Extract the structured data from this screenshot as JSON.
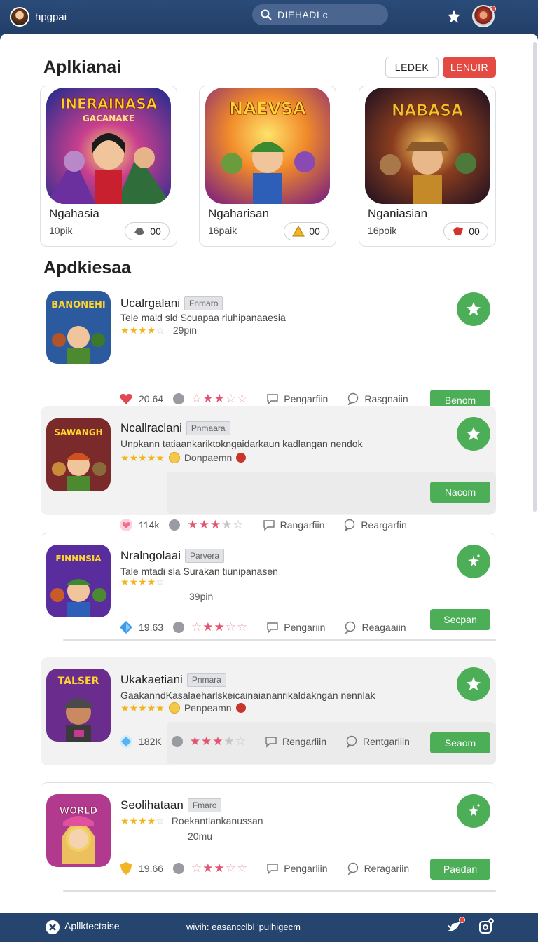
{
  "header": {
    "brand_name": "hpgpai",
    "search_value": "DIEHADI c",
    "icons": [
      "puzzle-icon",
      "shop-icon",
      "avatar"
    ]
  },
  "featured": {
    "title": "Aplkianai",
    "tabs": [
      {
        "label": "LEDEK",
        "style": "outline"
      },
      {
        "label": "LENUIR",
        "style": "red"
      }
    ],
    "cards": [
      {
        "art_title": "INERAINASA",
        "art_subtitle": "GACANAKE",
        "name": "Ngahasia",
        "count": "10pik",
        "pill_value": "00",
        "pill_icon": "rock-icon"
      },
      {
        "art_title": "NAEVSA",
        "art_subtitle": "",
        "name": "Ngaharisan",
        "count": "16paik",
        "pill_value": "00",
        "pill_icon": "warning-icon"
      },
      {
        "art_title": "NABASA",
        "art_subtitle": "",
        "name": "Nganiasian",
        "count": "16poik",
        "pill_value": "00",
        "pill_icon": "red-gem-icon"
      }
    ]
  },
  "list": {
    "title": "Apdkiesaa",
    "items": [
      {
        "art_title": "BANONEHI",
        "name": "Ucalrgalani",
        "tag": "Fnmaro",
        "desc": "Tele mald sld Scuapaa riuhipanaaesia",
        "sub": "29pin",
        "stat": "20.64",
        "badge_color": "#e4474f",
        "link1": "Pengarfiin",
        "link2": "Rasgnaiin",
        "action": "Benom",
        "fav_icon": "star-icon",
        "shaded": false
      },
      {
        "art_title": "SAWANGH",
        "name": "Ncallraclani",
        "tag": "Pnmaara",
        "desc": "Unpkann tatiaankariktokngaidarkaun kadlangan nendok",
        "sub": "Donpaemn",
        "stat": "114k",
        "badge_color": "#f36b8e",
        "link1": "Rangarfiin",
        "link2": "Reargarfin",
        "action": "Nacom",
        "fav_icon": "star-icon",
        "shaded": true
      },
      {
        "art_title": "FINNNSIA",
        "name": "Nralngolaai",
        "tag": "Parvera",
        "desc": "Tale mtadi sla Surakan tiunipanasen",
        "sub": "39pin",
        "stat": "19.63",
        "badge_color": "#3d9be9",
        "link1": "Pengariin",
        "link2": "Reagaaiin",
        "action": "Secpan",
        "fav_icon": "sparkle-icon",
        "shaded": false
      },
      {
        "art_title": "TALSER",
        "name": "Ukakaetiani",
        "tag": "Pnmara",
        "desc": "GaakanndKasalaeharlskeicainaiananrikaldakngan nennlak",
        "sub": "Penpeamn",
        "stat": "182K",
        "badge_color": "#56b3f0",
        "link1": "Rengarliin",
        "link2": "Rentgarliin",
        "action": "Seaom",
        "fav_icon": "star-icon",
        "shaded": true
      },
      {
        "art_title": "WORLD",
        "name": "Seolihataan",
        "tag": "Fmaro",
        "desc": "Roekantlankanussan",
        "sub": "20mu",
        "stat": "19.66",
        "badge_color": "#f3b526",
        "link1": "Pengarliin",
        "link2": "Reragariin",
        "action": "Paedan",
        "fav_icon": "sparkle-icon",
        "shaded": false
      }
    ]
  },
  "footer": {
    "left_label": "Apllktectaise",
    "center_text": "wivih: easancclbl 'pulhigecm",
    "icons": [
      "bird-icon",
      "settings-icon"
    ]
  },
  "colors": {
    "header_bg": "#25446e",
    "accent_green": "#4caf57",
    "accent_red": "#e24a43",
    "star_gold": "#f2b51c",
    "star_pink": "#e25470"
  }
}
